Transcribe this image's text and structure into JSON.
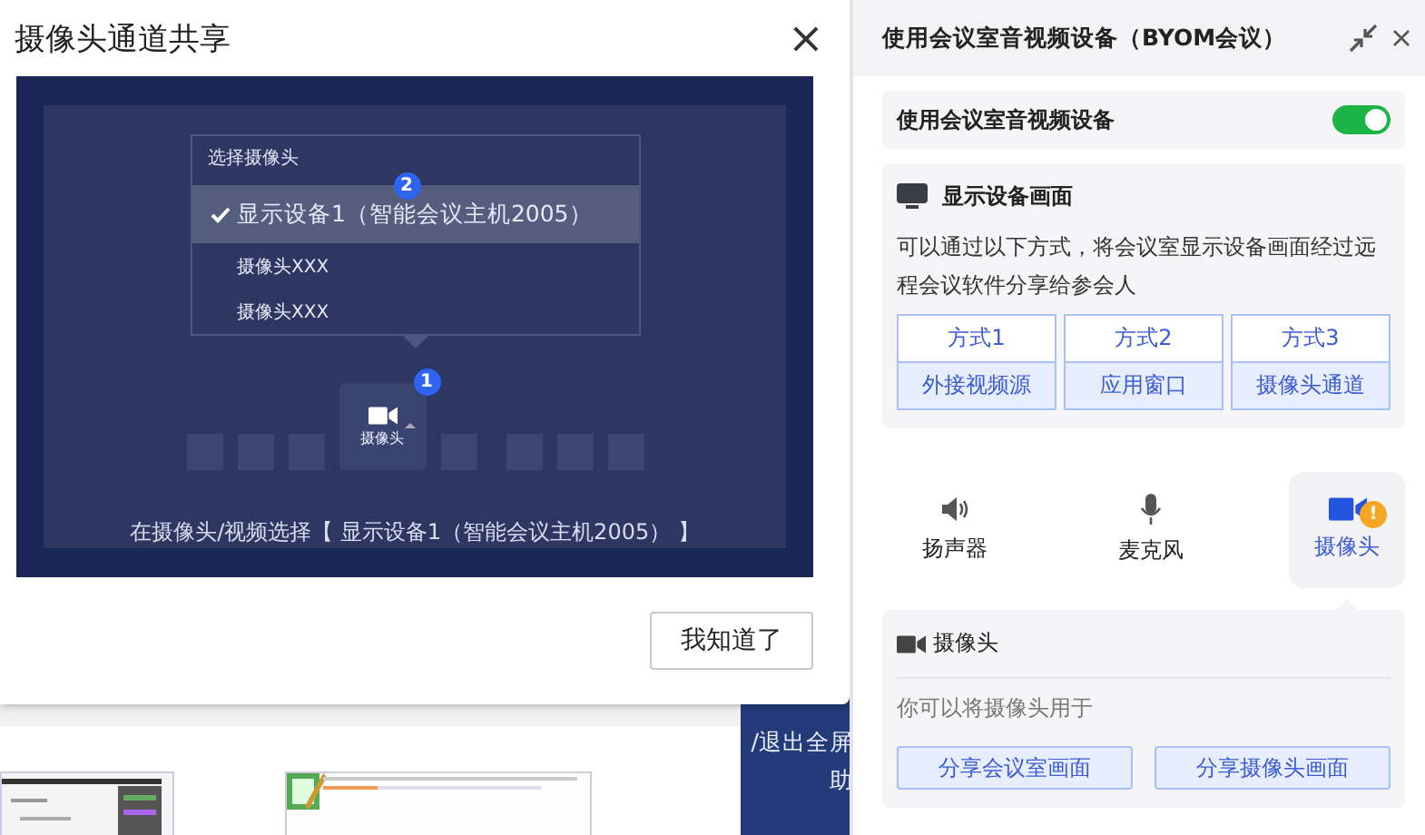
{
  "background": {
    "side_texts": [
      "/退出全屏",
      "助"
    ]
  },
  "dialog": {
    "title": "摄像头通道共享",
    "close": "×",
    "preview": {
      "dropdown_title": "选择摄像头",
      "options": [
        {
          "label": "显示设备1（智能会议主机2005）",
          "selected": true
        },
        {
          "label": "摄像头XXX",
          "selected": false
        },
        {
          "label": "摄像头XXX",
          "selected": false
        }
      ],
      "step_badges": [
        "1",
        "2"
      ],
      "camera_button": "摄像头",
      "caption": "在摄像头/视频选择【 显示设备1（智能会议主机2005） 】"
    },
    "confirm_button": "我知道了"
  },
  "panel": {
    "title": "使用会议室音视频设备（BYOM会议）",
    "toggle": {
      "label": "使用会议室音视频设备",
      "on": true
    },
    "display_card": {
      "title": "显示设备画面",
      "description": "可以通过以下方式，将会议室显示设备画面经过远程会议软件分享给参会人",
      "methods": [
        {
          "label": "方式1",
          "name": "外接视频源"
        },
        {
          "label": "方式2",
          "name": "应用窗口"
        },
        {
          "label": "方式3",
          "name": "摄像头通道"
        }
      ]
    },
    "devices": [
      {
        "kind": "speaker",
        "label": "扬声器",
        "selected": false
      },
      {
        "kind": "microphone",
        "label": "麦克风",
        "selected": false
      },
      {
        "kind": "camera",
        "label": "摄像头",
        "selected": true,
        "badge": "!"
      }
    ],
    "camera_card": {
      "title": "摄像头",
      "hint": "你可以将摄像头用于",
      "buttons": [
        "分享会议室画面",
        "分享摄像头画面"
      ]
    }
  }
}
